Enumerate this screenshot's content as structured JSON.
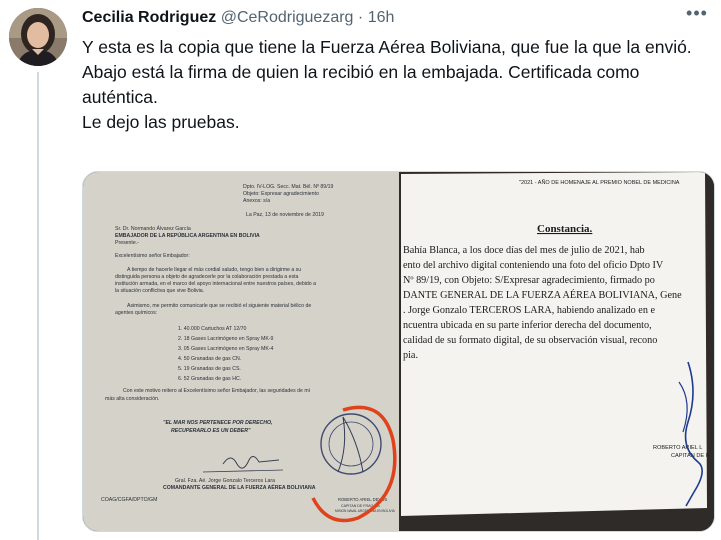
{
  "tweet": {
    "author_name": "Cecilia Rodriguez",
    "handle": "@CeRodriguezarg",
    "separator": "·",
    "time": "16h",
    "paragraphs": [
      "Y esta es la copia que tiene la Fuerza Aérea Boliviana, que fue la que la envió.",
      "Abajo está la firma de quien la recibió en la embajada. Certificada como auténtica.",
      "Le dejo las pruebas."
    ]
  },
  "left_document": {
    "ref_lines": [
      "Dpto. IV-LOG. Secc. Mat. Bél. Nº 89/19",
      "Objeto: Expresar agradecimiento",
      "Anexos: s/a"
    ],
    "date_line": "La Paz, 13 de noviembre de 2019",
    "addressee": [
      "Sr. Dr. Normando Álvarez García",
      "EMBAJADOR DE LA REPÚBLICA ARGENTINA EN BOLIVIA",
      "Presente.-"
    ],
    "salutation": "Excelentísimo señor Embajador:",
    "body": [
      "A tiempo de hacerle llegar el más cordial saludo, tengo bien a dirigirme a su",
      "distinguida persona a objeto de agradecerle por la colaboración prestada a esta",
      "institución armada, en el marco del apoyo internacional entre nuestros países, debido a",
      "la situación conflictiva que vive Bolivia.",
      "Asimismo, me permito comunicarle que se recibió el siguiente material bélico de",
      "agentes químicos:"
    ],
    "items": [
      "1.  40.000 Cartuchos AT 12/70",
      "2.  18 Gases Lacrimógeno en Spray MK-9",
      "3.  05 Gases Lacrimógeno en Spray MK-4",
      "4.  50 Granadas de gas CN.",
      "5.  19 Granadas de gas CS.",
      "6.  52 Granadas de gas HC."
    ],
    "closing": [
      "Con este motivo reitero al Excelentísimo señor Embajador, las seguridades de mi",
      "más alta consideración."
    ],
    "motto": [
      "\"EL MAR NOS PERTENECE POR DERECHO,",
      "RECUPERARLO ES UN DEBER\""
    ],
    "signer": [
      "Gral. Fza. Aé. Jorge Gonzalo Terceros Lara",
      "COMANDANTE GENERAL DE LA FUERZA AÉREA BOLIVIANA"
    ],
    "footer_code": "COAG/CGFA/DPTO/GM",
    "receiver": [
      "ROBERTO ARIEL DEVOS",
      "CAPITAN DE FRAGATA",
      "MISION NAVAL ARGENTINA EN BOLIVIA"
    ]
  },
  "right_document": {
    "header": "\"2021 - AÑO DE HOMENAJE AL PREMIO NOBEL DE MEDICINA",
    "title": "Constancia.",
    "lines": [
      "Bahía Blanca, a los doce días del mes de julio de 2021, hab",
      "ento del archivo digital conteniendo una foto del oficio Dpto IV",
      "Nº 89/19, con Objeto: S/Expresar agradecimiento, firmado po",
      "DANTE GENERAL DE LA FUERZA AÉREA BOLIVIANA, Gene",
      ". Jorge Gonzalo TERCEROS LARA, habiendo analizado en e",
      "ncuentra ubicada en su parte inferior derecha del documento,",
      "calidad de su formato digital, de su observación visual, recono",
      "pia."
    ],
    "signature": [
      "ROBERTO ARIEL L",
      "CAPITAN DE F"
    ]
  },
  "colors": {
    "text": "#0f1419",
    "secondary": "#536471",
    "border": "#cfd9de",
    "red_mark": "#e0421c"
  }
}
